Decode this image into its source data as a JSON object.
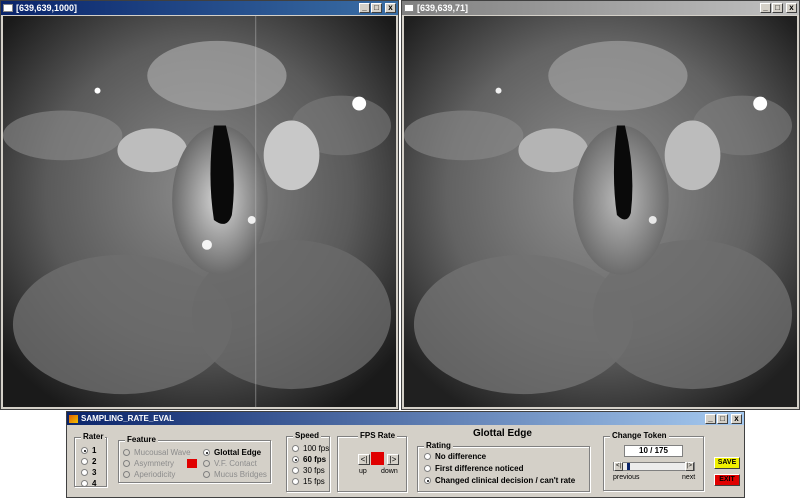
{
  "left_window": {
    "title": "[639,639,1000]"
  },
  "right_window": {
    "title": "[639,639,71]"
  },
  "window_controls": {
    "minimize": "_",
    "maximize": "□",
    "close": "x"
  },
  "panel": {
    "title": "SAMPLING_RATE_EVAL",
    "rater": {
      "title": "Rater",
      "options": [
        "1",
        "2",
        "3",
        "4"
      ],
      "selected": "1"
    },
    "feature": {
      "title": "Feature",
      "options": [
        "Mucousal Wave",
        "Asymmetry",
        "Aperiodicity",
        "Glottal Edge",
        "V.F. Contact",
        "Mucus Bridges"
      ],
      "selected": "Glottal Edge",
      "indicator_color": "#e00000"
    },
    "speed": {
      "title": "Speed",
      "options": [
        "100 fps",
        "60 fps",
        "30 fps",
        "15 fps"
      ],
      "selected": "60 fps"
    },
    "fps_rate": {
      "title": "FPS Rate",
      "up_label": "up",
      "down_label": "down",
      "left_arrow": "<|",
      "right_arrow": "|>",
      "indicator_color": "#e00000"
    },
    "heading": "Glottal Edge",
    "rating": {
      "title": "Rating",
      "options": [
        "No difference",
        "First difference noticed",
        "Changed clinical decision / can't rate"
      ],
      "selected": "Changed clinical decision / can't rate"
    },
    "change_token": {
      "title": "Change Token",
      "value": "10 / 175",
      "previous_label": "previous",
      "next_label": "next",
      "left_arrow": "<|",
      "right_arrow": "|>",
      "position_fraction": 0.06
    },
    "save_label": "SAVE",
    "exit_label": "EXIT",
    "save_color": "#f0f000",
    "exit_color": "#e00000"
  }
}
